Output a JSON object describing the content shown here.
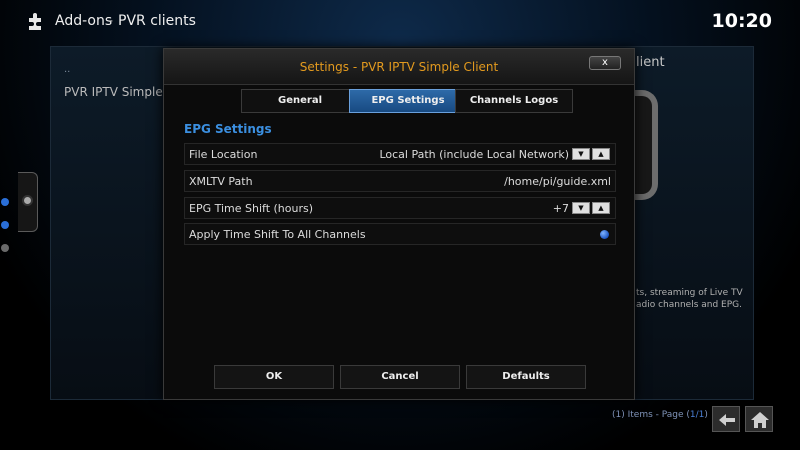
{
  "header": {
    "crumb_main": "Add-ons",
    "crumb_separator": "-",
    "crumb_sub": "PVR clients",
    "clock": "10:20"
  },
  "background": {
    "list_dash": "..",
    "list_item": "PVR IPTV Simple C",
    "title_partial": "lient",
    "description_line1": "ts, streaming of Live TV",
    "description_line2": "adio channels and EPG.",
    "pager_items": "(1) Items - Page (",
    "pager_page": "1/1",
    "pager_close": ")"
  },
  "dialog": {
    "title": "Settings - PVR IPTV Simple Client",
    "close_label": "x",
    "tabs": [
      {
        "label": "General",
        "active": false
      },
      {
        "label": "EPG Settings",
        "active": true
      },
      {
        "label": "Channels Logos",
        "active": false
      }
    ],
    "section_heading": "EPG Settings",
    "settings": [
      {
        "label": "File Location",
        "value": "Local Path (include Local Network)",
        "control": "spinner"
      },
      {
        "label": "XMLTV Path",
        "value": "/home/pi/guide.xml",
        "control": "text"
      },
      {
        "label": "EPG Time Shift (hours)",
        "value": "+7",
        "control": "spinner"
      },
      {
        "label": "Apply Time Shift To All Channels",
        "value": "",
        "control": "radio"
      }
    ],
    "buttons": {
      "ok": "OK",
      "cancel": "Cancel",
      "defaults": "Defaults"
    }
  },
  "colors": {
    "accent_blue": "#2e6aa8",
    "title_orange": "#e39a1e",
    "heading_blue": "#3b8fe0"
  }
}
